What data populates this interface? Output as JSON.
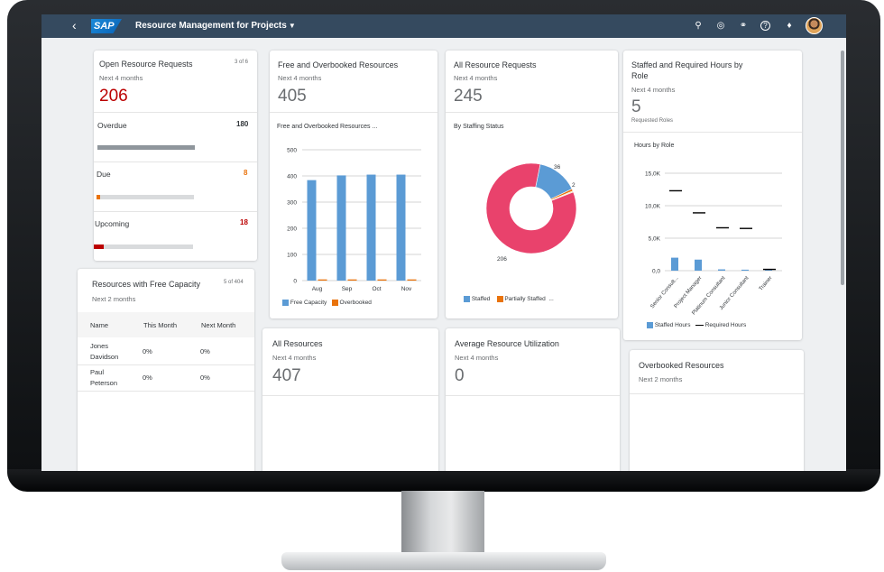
{
  "shell": {
    "logo": "SAP",
    "app_title": "Resource Management for Projects",
    "icons": [
      "back-icon",
      "search-icon",
      "co-pilot-icon",
      "headset-icon",
      "help-icon",
      "notification-icon",
      "user-avatar"
    ]
  },
  "tiles": {
    "open_requests": {
      "title": "Open Resource Requests",
      "counter": "3 of 6",
      "subtitle": "Next 4 months",
      "kpi": "206",
      "rows": [
        {
          "label": "Overdue",
          "value": "180",
          "fill": 1.0,
          "color": "#8f969c"
        },
        {
          "label": "Due",
          "value": "8",
          "fill": 0.04,
          "color": "#e9730c"
        },
        {
          "label": "Upcoming",
          "value": "18",
          "fill": 0.1,
          "color": "#bb0000"
        }
      ]
    },
    "free_capacity": {
      "title": "Resources with Free Capacity",
      "counter": "5 of 404",
      "subtitle": "Next 2 months",
      "columns": [
        "Name",
        "This Month",
        "Next Month"
      ],
      "rows": [
        {
          "name_line1": "Jones",
          "name_line2": "Davidson",
          "this_month": "0%",
          "next_month": "0%"
        },
        {
          "name_line1": "Paul",
          "name_line2": "Peterson",
          "this_month": "0%",
          "next_month": "0%"
        }
      ]
    },
    "free_overbooked": {
      "title": "Free and Overbooked Resources",
      "subtitle": "Next 4 months",
      "kpi": "405",
      "chart_title": "Free and Overbooked Resources ..."
    },
    "all_requests": {
      "title": "All Resource Requests",
      "subtitle": "Next 4 months",
      "kpi": "245",
      "chart_title": "By Staffing Status"
    },
    "staffed_required": {
      "title_line1": "Staffed and Required Hours by",
      "title_line2": "Role",
      "subtitle": "Next 4 months",
      "kpi": "5",
      "kpi_unit": "Requested Roles",
      "chart_title": "Hours by Role"
    },
    "all_resources": {
      "title": "All Resources",
      "subtitle": "Next 4 months",
      "kpi": "407"
    },
    "avg_utilization": {
      "title": "Average Resource Utilization",
      "subtitle": "Next 4 months",
      "kpi": "0"
    },
    "overbooked": {
      "title": "Overbooked Resources",
      "subtitle": "Next 2 months"
    }
  },
  "chart_data": [
    {
      "type": "bar",
      "categories": [
        "Aug",
        "Sep",
        "Oct",
        "Nov"
      ],
      "series": [
        {
          "name": "Free Capacity",
          "values": [
            384,
            402,
            405,
            405
          ],
          "color": "#5b9bd5"
        },
        {
          "name": "Overbooked",
          "values": [
            1,
            1,
            1,
            1
          ],
          "color": "#e9730c"
        }
      ],
      "yticks": [
        "0",
        "100",
        "200",
        "300",
        "400",
        "500"
      ],
      "ylim": [
        0,
        500
      ]
    },
    {
      "type": "pie",
      "donut": true,
      "slices": [
        {
          "name": "Staffed",
          "value": 36,
          "color": "#5b9bd5"
        },
        {
          "name": "Partially Staffed",
          "value": 2,
          "color": "#e9730c"
        },
        {
          "name": "",
          "value": 1,
          "color": "#f0e4a8"
        },
        {
          "name": "",
          "value": 206,
          "color": "#e9426c"
        }
      ],
      "labels": [
        "36",
        "2",
        "206"
      ],
      "legend": [
        "Staffed",
        "Partially Staffed",
        "..."
      ]
    },
    {
      "type": "bar",
      "categories": [
        "Senior Consult...",
        "Project Manager",
        "Platinum Consultant",
        "Junior Consultant",
        "Trainer"
      ],
      "series": [
        {
          "name": "Staffed Hours",
          "values": [
            2000,
            1700,
            200,
            150,
            150
          ],
          "color": "#5b9bd5"
        },
        {
          "name": "Required Hours",
          "values": [
            12300,
            8900,
            6600,
            6500,
            200
          ],
          "color": "#000000"
        }
      ],
      "yticks": [
        "0,0",
        "5,0K",
        "10,0K",
        "15,0K"
      ],
      "ylim": [
        0,
        15000
      ]
    }
  ]
}
